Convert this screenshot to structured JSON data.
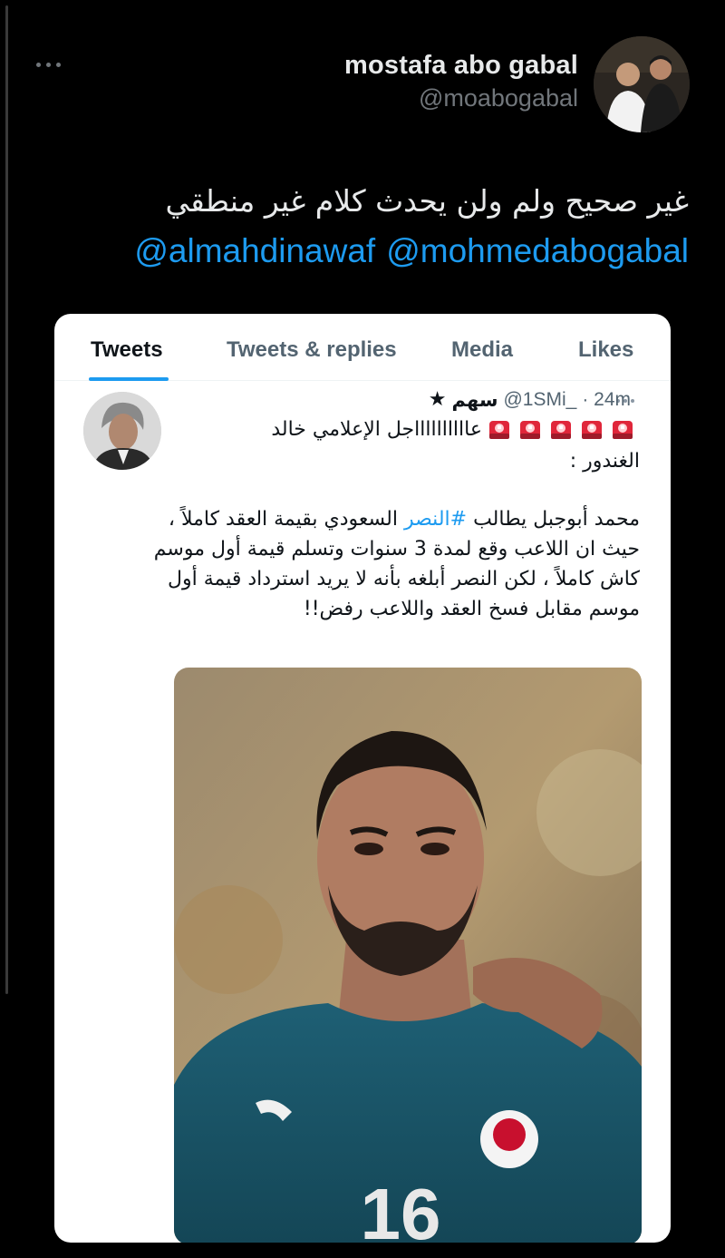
{
  "tweet": {
    "author_name": "mostafa abo gabal",
    "author_handle": "@moabogabal",
    "text": "غير صحيح ولم ولن يحدث كلام غير منطقي",
    "mentions": [
      "@mohmedabogabal",
      "@almahdinawaf"
    ]
  },
  "quoted_screenshot": {
    "tabs": [
      "Tweets",
      "Tweets & replies",
      "Media",
      "Likes"
    ],
    "active_tab": "Tweets",
    "author_name": "سهم",
    "author_star": "★",
    "author_handle": "@1SMi_",
    "time": "· 24m",
    "line1_text": "عااااااااااجل الإعلامي خالد",
    "line2_text": "الغندور :",
    "body_before": "محمد أبوجبل يطالب ",
    "hashtag": "#النصر",
    "body_after": " السعودي بقيمة العقد كاملاً ، حيث ان اللاعب وقع لمدة 3 سنوات وتسلم قيمة أول موسم كاش كاملاً ، لكن النصر أبلغه بأنه لا يريد استرداد قيمة أول موسم مقابل فسخ العقد واللاعب رفض!!",
    "siren_count": 5
  },
  "colors": {
    "link": "#1d9bf0",
    "background": "#000000",
    "card": "#ffffff"
  }
}
